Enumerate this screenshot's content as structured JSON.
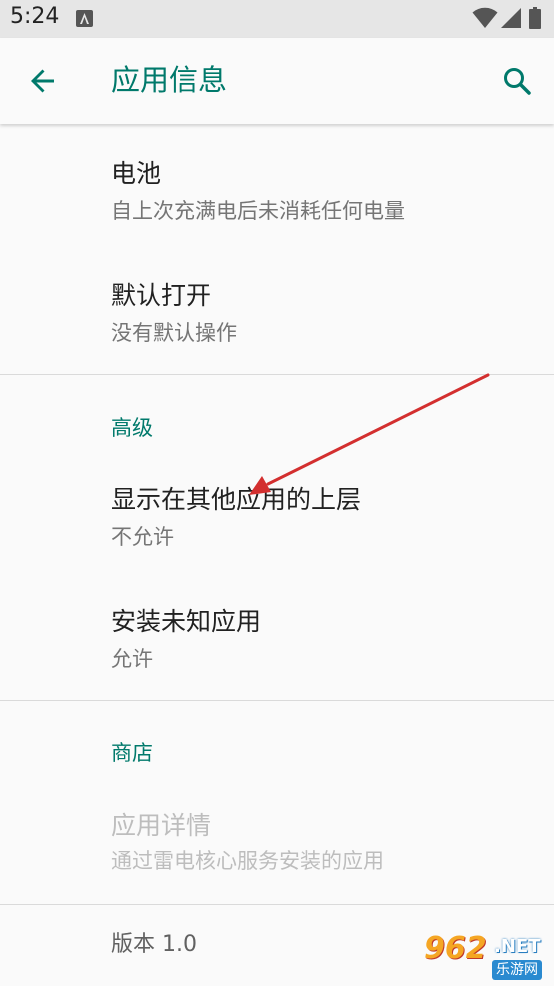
{
  "status_bar": {
    "time": "5:24"
  },
  "app_bar": {
    "title": "应用信息"
  },
  "items": {
    "battery": {
      "title": "电池",
      "subtitle": "自上次充满电后未消耗任何电量"
    },
    "open_by_default": {
      "title": "默认打开",
      "subtitle": "没有默认操作"
    },
    "display_over_apps": {
      "title": "显示在其他应用的上层",
      "subtitle": "不允许"
    },
    "install_unknown": {
      "title": "安装未知应用",
      "subtitle": "允许"
    },
    "app_details": {
      "title": "应用详情",
      "subtitle": "通过雷电核心服务安装的应用"
    }
  },
  "sections": {
    "advanced": "高级",
    "store": "商店"
  },
  "version": "版本 1.0",
  "watermark": {
    "number": "962",
    "domain": ".NET",
    "name": "乐游网"
  },
  "colors": {
    "accent": "#00796b",
    "annotation_arrow": "#d32f2f",
    "background": "#fafafa"
  }
}
